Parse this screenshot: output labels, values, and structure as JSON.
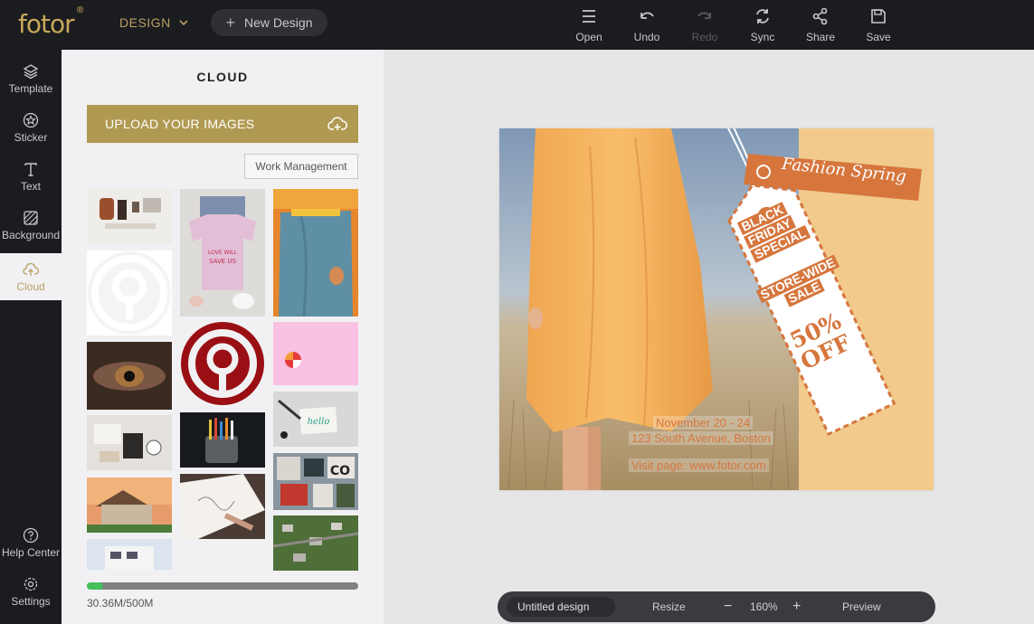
{
  "app": {
    "logo": "fotor",
    "logo_mark": "®"
  },
  "header": {
    "design_menu": "DESIGN",
    "new_design": "New Design",
    "tools": [
      {
        "id": "open",
        "label": "Open",
        "icon": "menu-icon"
      },
      {
        "id": "undo",
        "label": "Undo",
        "icon": "undo-icon"
      },
      {
        "id": "redo",
        "label": "Redo",
        "icon": "redo-icon"
      },
      {
        "id": "sync",
        "label": "Sync",
        "icon": "sync-icon"
      },
      {
        "id": "share",
        "label": "Share",
        "icon": "share-icon"
      },
      {
        "id": "save",
        "label": "Save",
        "icon": "save-icon"
      }
    ]
  },
  "leftnav": {
    "items": [
      {
        "label": "Template",
        "icon": "layers-icon"
      },
      {
        "label": "Sticker",
        "icon": "sticker-icon"
      },
      {
        "label": "Text",
        "icon": "text-icon"
      },
      {
        "label": "Background",
        "icon": "background-icon"
      },
      {
        "label": "Cloud",
        "icon": "cloud-upload-icon",
        "active": true
      }
    ],
    "bottom_items": [
      {
        "label": "Help Center",
        "icon": "help-icon"
      },
      {
        "label": "Settings",
        "icon": "settings-icon"
      }
    ]
  },
  "panel": {
    "title": "CLOUD",
    "upload_label": "UPLOAD YOUR IMAGES",
    "work_management": "Work Management",
    "storage": {
      "used_text": "30.36M/500M",
      "fraction": 0.0607
    }
  },
  "design": {
    "tag_title": "Fashion Spring",
    "tag_line1": "BLACK",
    "tag_line2": "FRIDAY",
    "tag_line3": "SPECIAL",
    "tag_line4": "STORE-WIDE",
    "tag_line5": "SALE",
    "tag_line6": "50%",
    "tag_line7": "OFF",
    "date": "November 20 - 24",
    "address": "123 South Avenue, Boston",
    "visit": "Visit page: www.fotor.com"
  },
  "bottombar": {
    "doc_name": "Untitled design",
    "resize": "Resize",
    "zoom_minus": "−",
    "zoom": "160%",
    "zoom_plus": "+",
    "preview": "Preview"
  },
  "colors": {
    "accent": "#b09a52",
    "dark": "#1b1c20",
    "tag_orange": "#d6763d"
  }
}
